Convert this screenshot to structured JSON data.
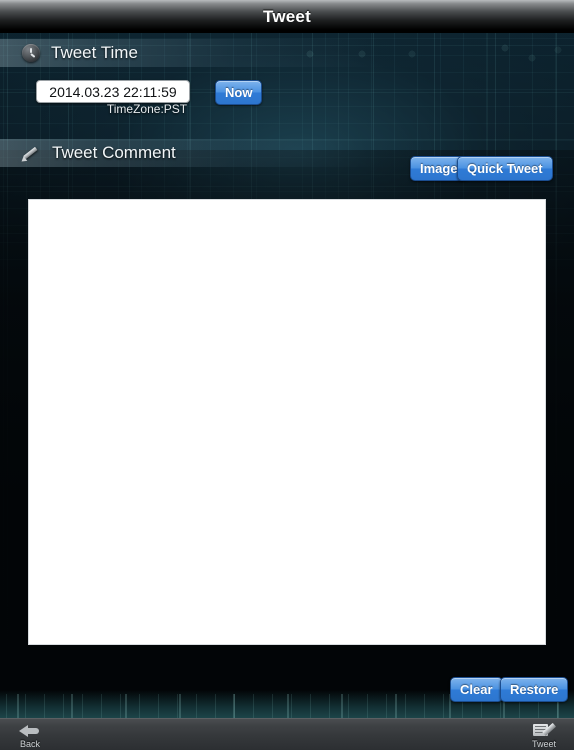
{
  "titlebar": {
    "title": "Tweet"
  },
  "sections": {
    "time": {
      "header": "Tweet Time",
      "icon": "clock-icon",
      "date_value": "2014.03.23 22:11:59",
      "date_placeholder": "YYYY.MM.DD HH:MM:SS",
      "now_label": "Now",
      "timezone": "TimeZone:PST"
    },
    "comment": {
      "header": "Tweet Comment",
      "icon": "pencil-icon",
      "image_label": "Image",
      "quick_tweet_label": "Quick Tweet",
      "text_value": "",
      "clear_label": "Clear",
      "restore_label": "Restore"
    }
  },
  "toolbar": {
    "back_label": "Back",
    "back_icon": "back-arrow-icon",
    "tweet_label": "Tweet",
    "tweet_icon": "compose-icon"
  },
  "colors": {
    "accent_blue": "#3d86dc",
    "background_dark": "#060a0d",
    "panel_white": "#ffffff",
    "title_text": "#ffffff"
  }
}
